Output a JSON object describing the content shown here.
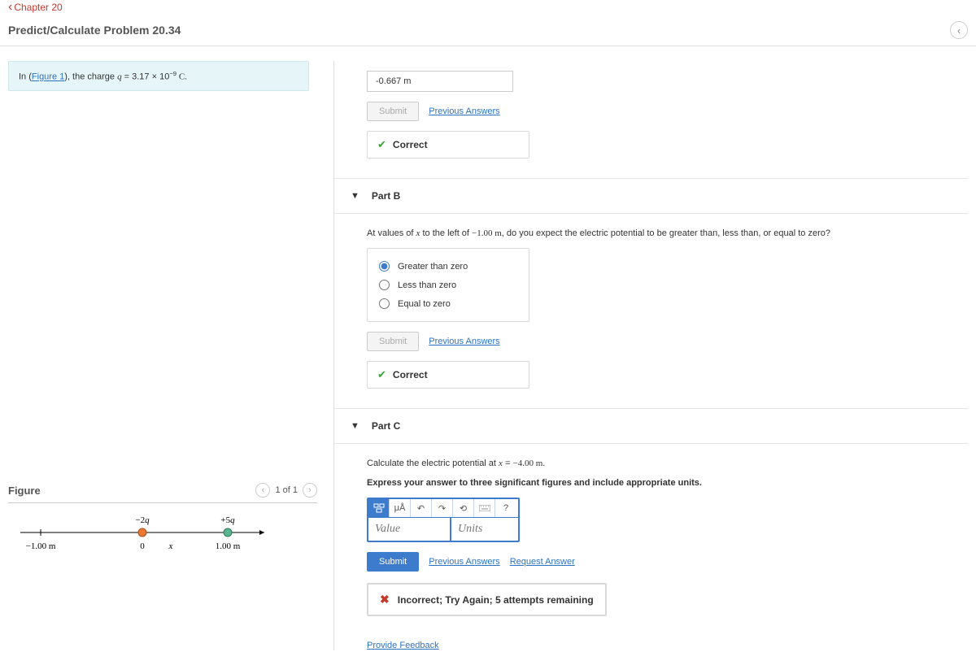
{
  "nav": {
    "back": "Chapter 20"
  },
  "title": "Predict/Calculate Problem 20.34",
  "intro": {
    "prefix": "In (",
    "figlink": "Figure 1",
    "mid": "), the charge ",
    "var": "q",
    "eq": " = 3.17 × 10",
    "exp": "−9",
    "unit": " C."
  },
  "figure": {
    "title": "Figure",
    "counter": "1 of 1",
    "labels": {
      "leftTick": "−1.00 m",
      "midTick": "0",
      "rightTick": "1.00 m",
      "axis": "x",
      "leftCharge": "−2q",
      "rightCharge": "+5q"
    }
  },
  "partA": {
    "answer": "-0.667 m",
    "submit": "Submit",
    "prev": "Previous Answers",
    "correct": "Correct"
  },
  "partB": {
    "title": "Part B",
    "q_pre": "At values of ",
    "q_var": "x",
    "q_mid": " to the left of ",
    "q_val": "−1.00 m",
    "q_post": ", do you expect the electric potential to be greater than, less than, or equal to zero?",
    "opt1": "Greater than zero",
    "opt2": "Less than zero",
    "opt3": "Equal to zero",
    "submit": "Submit",
    "prev": "Previous Answers",
    "correct": "Correct"
  },
  "partC": {
    "title": "Part C",
    "q_pre": "Calculate the electric potential at ",
    "q_var": "x",
    "q_eq": " = ",
    "q_val": "−4.00 m",
    "q_post": ".",
    "instruct": "Express your answer to three significant figures and include appropriate units.",
    "valuePlaceholder": "Value",
    "unitsPlaceholder": "Units",
    "submit": "Submit",
    "prev": "Previous Answers",
    "req": "Request Answer",
    "incorrect": "Incorrect; Try Again; 5 attempts remaining",
    "tb_mu": "μÅ"
  },
  "feedback": "Provide Feedback"
}
